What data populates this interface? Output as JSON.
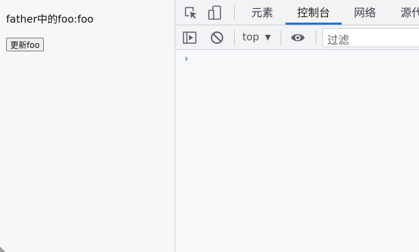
{
  "page": {
    "text": "father中的foo:foo",
    "button_label": "更新foo"
  },
  "devtools": {
    "tabs": [
      {
        "label": "元素",
        "active": false
      },
      {
        "label": "控制台",
        "active": true
      },
      {
        "label": "网络",
        "active": false
      },
      {
        "label": "源代",
        "active": false
      }
    ],
    "toolbar": {
      "context": "top",
      "filter_placeholder": "过滤"
    },
    "console": {
      "prompt": "›"
    }
  },
  "colors": {
    "accent": "#1a73e8",
    "tab_bg": "#f1f3f4",
    "panel_bg": "#f8f9fa"
  },
  "icons": [
    "inspect-element-icon",
    "device-toolbar-icon",
    "sidebar-toggle-icon",
    "clear-console-icon",
    "dropdown-triangle-icon",
    "eye-icon",
    "console-prompt-icon"
  ]
}
